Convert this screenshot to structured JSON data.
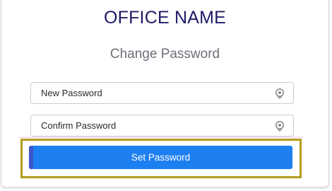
{
  "header": {
    "office_name": "OFFICE NAME",
    "subtitle": "Change Password"
  },
  "form": {
    "new_password": {
      "placeholder": "New Password",
      "value": "",
      "icon": "eye-toggle-icon"
    },
    "confirm_password": {
      "placeholder": "Confirm Password",
      "value": "",
      "icon": "eye-toggle-icon"
    },
    "submit_label": "Set Password"
  },
  "colors": {
    "title": "#1f1a66",
    "subtitle": "#6b6f78",
    "button": "#1d7ff0",
    "button_accent": "#3c55c9",
    "highlight_border": "#b39d1e"
  }
}
